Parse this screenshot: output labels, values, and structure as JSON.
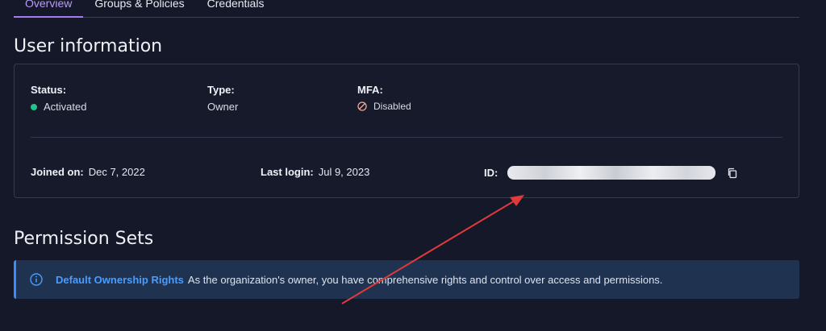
{
  "tabs": [
    {
      "label": "Overview",
      "active": true
    },
    {
      "label": "Groups & Policies",
      "active": false
    },
    {
      "label": "Credentials",
      "active": false
    }
  ],
  "user_info": {
    "title": "User information",
    "status": {
      "label": "Status:",
      "value": "Activated",
      "color": "#25c38a"
    },
    "type": {
      "label": "Type:",
      "value": "Owner"
    },
    "mfa": {
      "label": "MFA:",
      "value": "Disabled",
      "icon": "ban-icon"
    },
    "joined": {
      "label": "Joined on:",
      "value": "Dec 7, 2022"
    },
    "last_login": {
      "label": "Last login:",
      "value": "Jul 9, 2023"
    },
    "id": {
      "label": "ID:",
      "icon": "copy-icon"
    }
  },
  "permissions": {
    "title": "Permission Sets",
    "banner": {
      "icon": "info-icon",
      "strong": "Default Ownership Rights",
      "text": "As the organization's owner, you have comprehensive rights and control over access and permissions."
    }
  },
  "colors": {
    "accent": "#a47cf0",
    "info": "#3b8cff",
    "annotation_arrow": "#e03a3a"
  }
}
